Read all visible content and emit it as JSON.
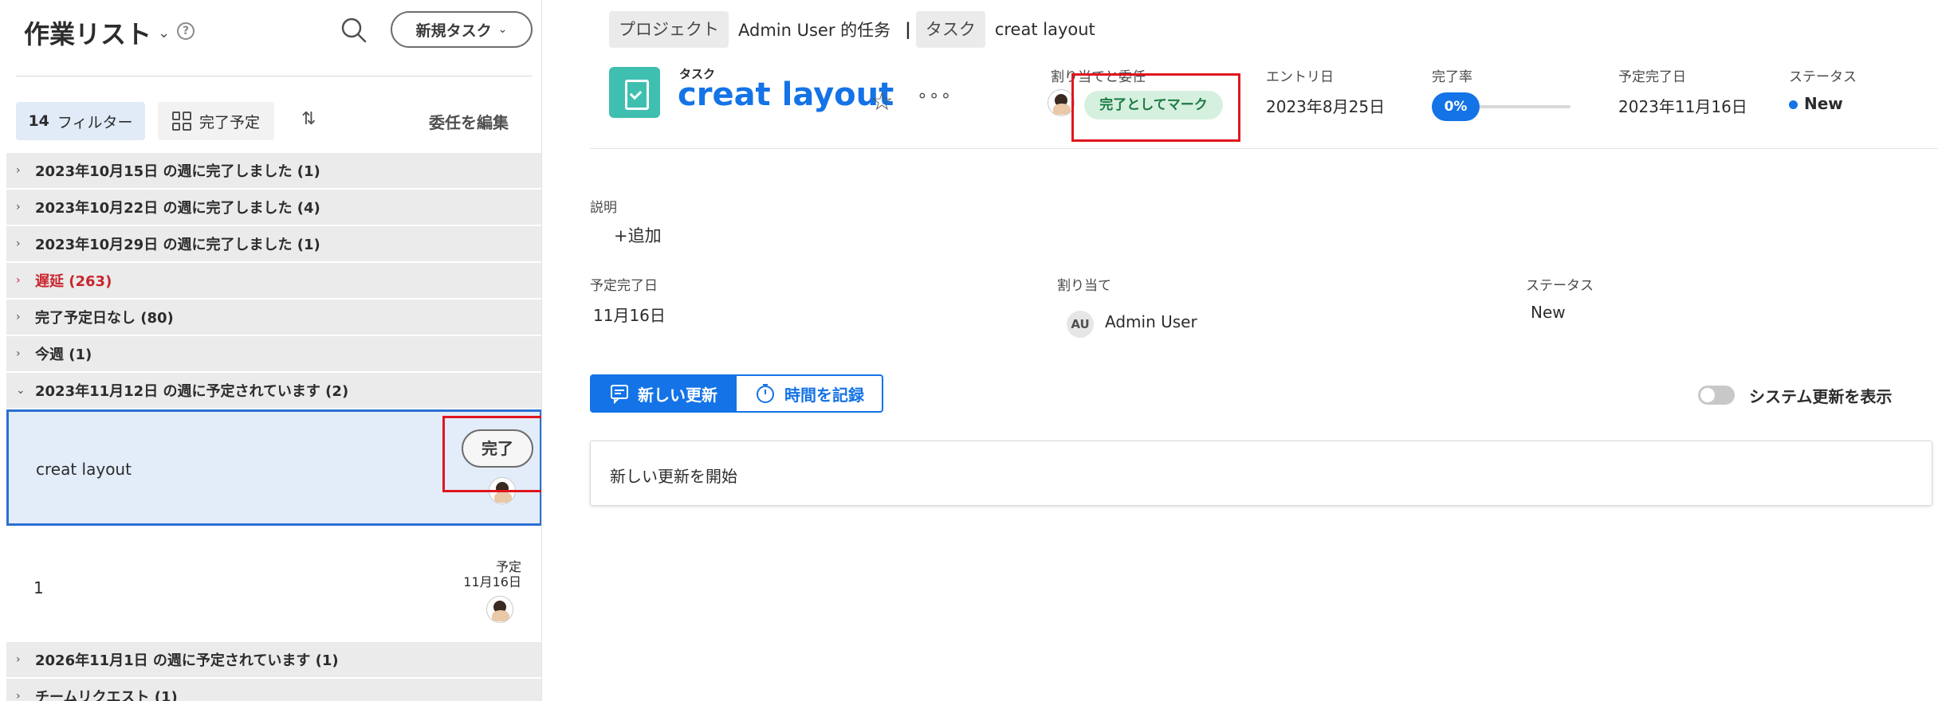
{
  "left_panel": {
    "title": "作業リスト",
    "new_task_label": "新規タスク",
    "filter": {
      "count": "14",
      "label": "フィルター"
    },
    "due_label": "完了予定",
    "delegate_label": "委任を編集",
    "groups_before": [
      {
        "label": "2023年10月15日 の週に完了しました (1)",
        "type": "normal"
      },
      {
        "label": "2023年10月22日 の週に完了しました (4)",
        "type": "normal"
      },
      {
        "label": "2023年10月29日 の週に完了しました (1)",
        "type": "normal"
      },
      {
        "label": "遅延 (263)",
        "type": "overdue"
      },
      {
        "label": "完了予定日なし (80)",
        "type": "normal"
      },
      {
        "label": "今週 (1)",
        "type": "normal"
      },
      {
        "label": "2023年11月12日 の週に予定されています (2)",
        "type": "expanded"
      }
    ],
    "tasks": [
      {
        "name": "creat layout",
        "done_label": "完了"
      },
      {
        "name": "1",
        "due_line1": "予定",
        "due_line2": "11月16日"
      }
    ],
    "groups_after": [
      {
        "label": "2026年11月1日 の週に予定されています (1)"
      },
      {
        "label": "チームリクエスト (1)"
      }
    ]
  },
  "breadcrumb": {
    "project_chip": "プロジェクト",
    "project_name": "Admin User 的任务",
    "separator": "|",
    "task_chip": "タスク",
    "task_name": "creat layout"
  },
  "header": {
    "type_label": "タスク",
    "title": "creat layout",
    "assign_label": "割り当てと委任",
    "mark_done_label": "完了としてマーク",
    "entry_label": "エントリ日",
    "entry_value": "2023年8月25日",
    "percent_label": "完了率",
    "percent_value": "0%",
    "percent": 0,
    "due_label": "予定完了日",
    "due_value": "2023年11月16日",
    "status_label": "ステータス",
    "status_value": "New"
  },
  "details": {
    "description_label": "説明",
    "add_label": "+追加",
    "due_label": "予定完了日",
    "due_value": "11月16日",
    "assign_label": "割り当て",
    "assignee_initials": "AU",
    "assignee_name": "Admin User",
    "status_label": "ステータス",
    "status_value": "New"
  },
  "updates": {
    "tab_new": "新しい更新",
    "tab_log_time": "時間を記録",
    "toggle_label": "システム更新を表示",
    "placeholder": "新しい更新を開始"
  },
  "colors": {
    "accent": "#1473e6",
    "overdue": "#c9252d",
    "highlight": "#e0161f",
    "task_icon": "#3fbfb0",
    "mark_done_bg": "#d6f0df"
  }
}
